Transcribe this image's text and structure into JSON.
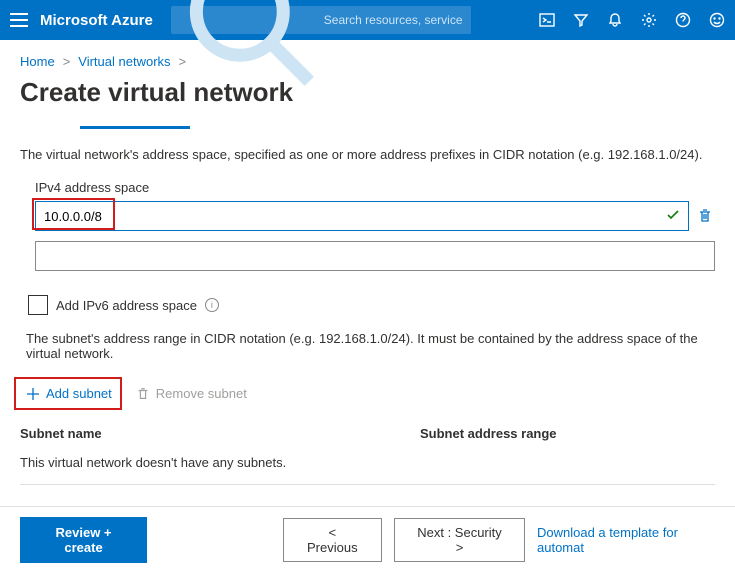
{
  "header": {
    "brand": "Microsoft Azure",
    "search_placeholder": "Search resources, services, and docs (G+/)"
  },
  "breadcrumb": {
    "home": "Home",
    "vnet": "Virtual networks"
  },
  "page": {
    "title": "Create virtual network",
    "addr_space_desc": "The virtual network's address space, specified as one or more address prefixes in CIDR notation (e.g. 192.168.1.0/24).",
    "ipv4_label": "IPv4 address space",
    "ipv4_value": "10.0.0.0/8",
    "ipv6_checkbox": "Add IPv6 address space",
    "subnet_desc": "The subnet's address range in CIDR notation (e.g. 192.168.1.0/24). It must be contained by the address space of the virtual network.",
    "add_subnet": "Add subnet",
    "remove_subnet": "Remove subnet",
    "col_name": "Subnet name",
    "col_range": "Subnet address range",
    "empty_subnets": "This virtual network doesn't have any subnets."
  },
  "footer": {
    "review": "Review + create",
    "previous": "<  Previous",
    "next": "Next : Security  >",
    "download": "Download a template for automat"
  }
}
